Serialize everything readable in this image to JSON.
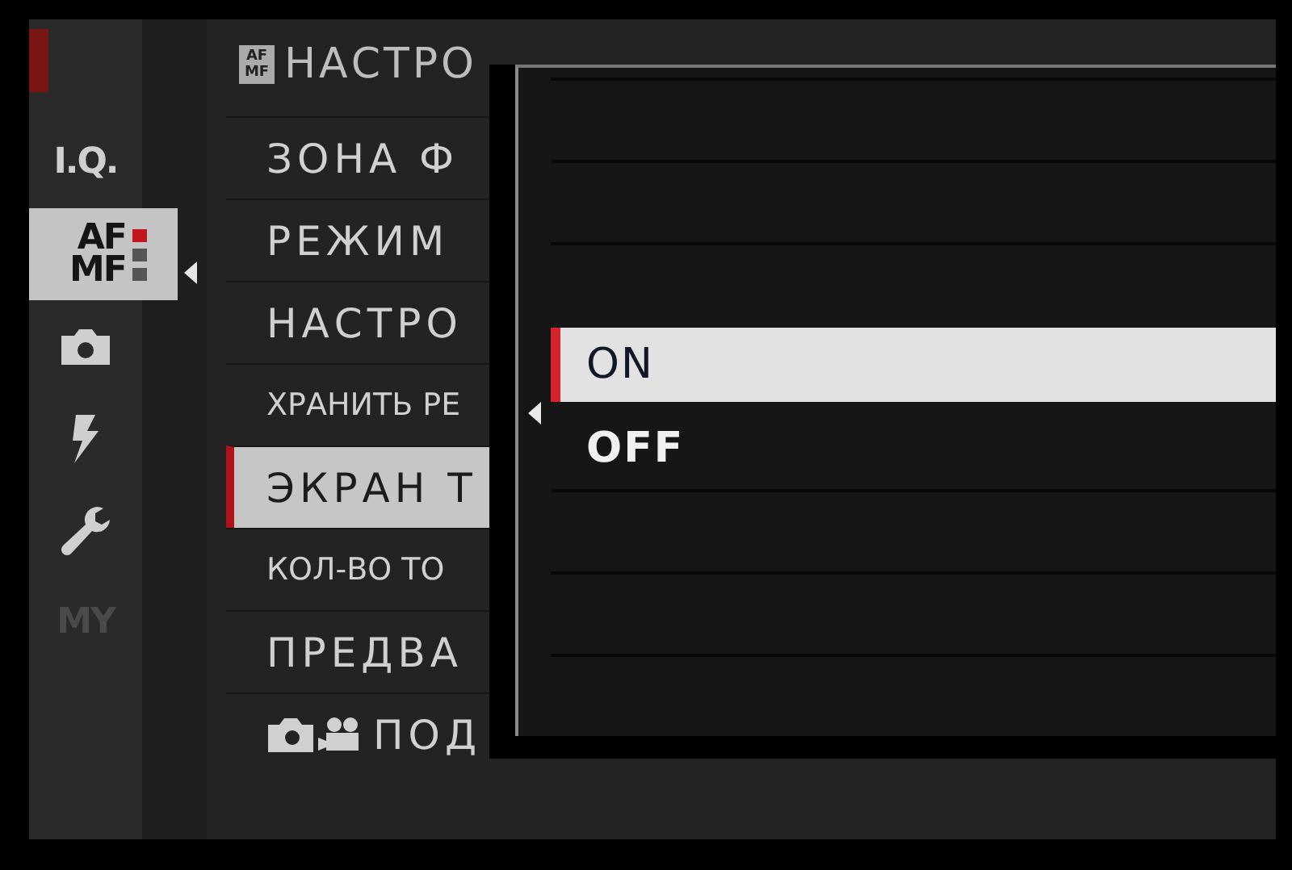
{
  "header": {
    "badge": [
      "AF",
      "MF"
    ],
    "title": "НАСТРО"
  },
  "sidebar": {
    "tabs": [
      {
        "kind": "text",
        "lines": [
          "I.Q."
        ],
        "selected": false,
        "disabled": false
      },
      {
        "kind": "text",
        "lines": [
          "AF",
          "MF"
        ],
        "selected": true,
        "disabled": false,
        "pages": [
          {
            "selected": true
          },
          {
            "selected": false
          },
          {
            "selected": false
          }
        ]
      },
      {
        "kind": "camera",
        "selected": false,
        "disabled": false
      },
      {
        "kind": "flash",
        "selected": false,
        "disabled": false
      },
      {
        "kind": "wrench",
        "selected": false,
        "disabled": false
      },
      {
        "kind": "text",
        "lines": [
          "MY"
        ],
        "selected": false,
        "disabled": true
      }
    ]
  },
  "menu": {
    "items": [
      {
        "kind": "plain",
        "label": "ЗОНА Ф",
        "selected": false
      },
      {
        "kind": "plain",
        "label": "РЕЖИМ",
        "selected": false
      },
      {
        "kind": "plain",
        "label": "НАСТРО",
        "selected": false
      },
      {
        "kind": "condensed",
        "label": "ХРАНИТЬ РЕ",
        "selected": false
      },
      {
        "kind": "plain",
        "label": "ЭКРАН Т",
        "selected": true
      },
      {
        "kind": "condensed",
        "label": "КОЛ-ВО ТО",
        "selected": false
      },
      {
        "kind": "plain",
        "label": "ПРЕДВА",
        "selected": false
      },
      {
        "kind": "photo-video",
        "label": "ПОД",
        "selected": false
      }
    ]
  },
  "popup": {
    "options": [
      {
        "label": "ON",
        "selected": true
      },
      {
        "label": "OFF",
        "selected": false
      }
    ]
  }
}
